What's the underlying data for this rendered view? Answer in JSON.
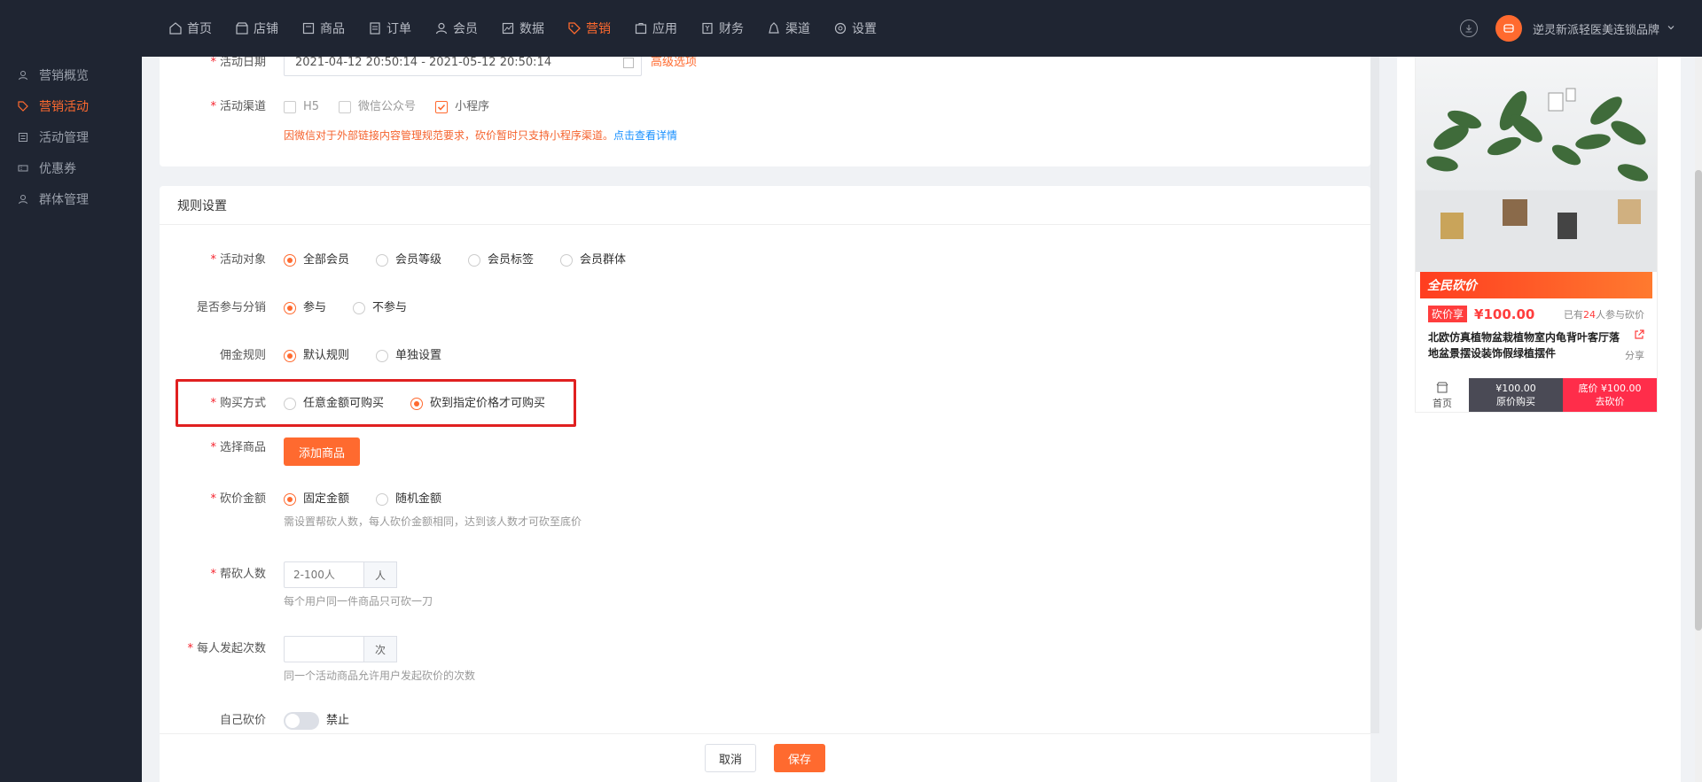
{
  "topnav": {
    "items": [
      {
        "label": "首页",
        "icon": "home-icon"
      },
      {
        "label": "店铺",
        "icon": "store-icon"
      },
      {
        "label": "商品",
        "icon": "goods-icon"
      },
      {
        "label": "订单",
        "icon": "order-icon"
      },
      {
        "label": "会员",
        "icon": "member-icon"
      },
      {
        "label": "数据",
        "icon": "chart-icon"
      },
      {
        "label": "营销",
        "icon": "tag-icon"
      },
      {
        "label": "应用",
        "icon": "app-icon"
      },
      {
        "label": "财务",
        "icon": "finance-icon"
      },
      {
        "label": "渠道",
        "icon": "channel-icon"
      },
      {
        "label": "设置",
        "icon": "gear-icon"
      }
    ],
    "active": "营销",
    "account_name": "逆灵新派轻医美连锁品牌"
  },
  "sidebar": {
    "items": [
      {
        "label": "营销概览"
      },
      {
        "label": "营销活动"
      },
      {
        "label": "活动管理"
      },
      {
        "label": "优惠券"
      },
      {
        "label": "群体管理"
      }
    ],
    "active": "营销活动"
  },
  "basic": {
    "date_label": "活动日期",
    "date_value": "2021-04-12 20:50:14 - 2021-05-12 20:50:14",
    "advanced_link": "高级选项",
    "channel_label": "活动渠道",
    "channels": [
      {
        "label": "H5",
        "checked": false
      },
      {
        "label": "微信公众号",
        "checked": false
      },
      {
        "label": "小程序",
        "checked": true
      }
    ],
    "channel_warning": "因微信对于外部链接内容管理规范要求，砍价暂时只支持小程序渠道。",
    "channel_link": "点击查看详情"
  },
  "rules": {
    "section_title": "规则设置",
    "target_label": "活动对象",
    "targets": [
      "全部会员",
      "会员等级",
      "会员标签",
      "会员群体"
    ],
    "target_selected": "全部会员",
    "dist_label": "是否参与分销",
    "dist_options": [
      "参与",
      "不参与"
    ],
    "dist_selected": "参与",
    "commission_label": "佣金规则",
    "commission_options": [
      "默认规则",
      "单独设置"
    ],
    "commission_selected": "默认规则",
    "buy_label": "购买方式",
    "buy_options": [
      "任意金额可购买",
      "砍到指定价格才可购买"
    ],
    "buy_selected": "砍到指定价格才可购买",
    "goods_label": "选择商品",
    "add_goods_button": "添加商品",
    "amount_label": "砍价金额",
    "amount_options": [
      "固定金额",
      "随机金额"
    ],
    "amount_selected": "固定金额",
    "amount_hint": "需设置帮砍人数，每人砍价金额相同，达到该人数才可砍至底价",
    "helpers_label": "帮砍人数",
    "helpers_placeholder": "2-100人",
    "helpers_suffix": "人",
    "helpers_hint": "每个用户同一件商品只可砍一刀",
    "times_label": "每人发起次数",
    "times_value": "",
    "times_suffix": "次",
    "times_hint": "同一个活动商品允许用户发起砍价的次数",
    "self_cut_label": "自己砍价",
    "self_cut_state": "禁止"
  },
  "footer": {
    "cancel": "取消",
    "save": "保存"
  },
  "preview": {
    "banner": "全民砍价",
    "tag": "砍价享",
    "price": "¥100.00",
    "joined_prefix": "已有",
    "joined_count": "24",
    "joined_suffix": "人参与砍价",
    "product_name": "北欧仿真植物盆栽植物室内龟背叶客厅落地盆景摆设装饰假绿植摆件",
    "share": "分享",
    "home": "首页",
    "buy_price": "¥100.00",
    "buy_label": "原价购买",
    "cut_price": "底价 ¥100.00",
    "cut_label": "去砍价"
  },
  "colors": {
    "accent": "#ff6a2f",
    "nav_bg": "#1f2532",
    "required": "#f5222d",
    "highlight_border": "#e02020"
  }
}
